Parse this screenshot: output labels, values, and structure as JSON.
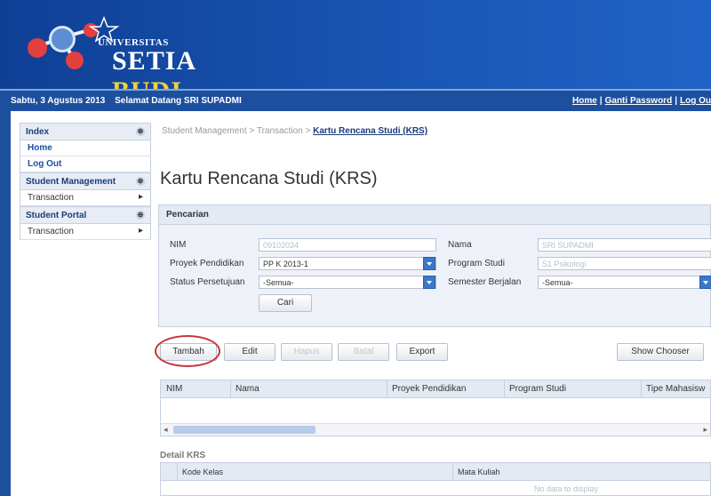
{
  "header": {
    "logo_top": "UNIVERSITAS",
    "logo_brand_a": "SETIA",
    "logo_brand_b": "BUDI"
  },
  "topbar": {
    "date": "Sabtu, 3 Agustus 2013",
    "welcome": "Selamat Datang SRI SUPADMI",
    "links": [
      "Home",
      "Ganti Password",
      "Log Ou"
    ]
  },
  "sidebar": {
    "sections": [
      {
        "title": "Index",
        "items": [
          "Home",
          "Log Out"
        ]
      },
      {
        "title": "Student Management",
        "items": [
          "Transaction"
        ]
      },
      {
        "title": "Student Portal",
        "items": [
          "Transaction"
        ]
      }
    ]
  },
  "breadcrumb": {
    "path1": "Student Management",
    "sep": ">",
    "path2": "Transaction",
    "current": "Kartu Rencana Studi (KRS)"
  },
  "page_title": "Kartu Rencana Studi (KRS)",
  "search": {
    "panel_title": "Pencarian",
    "nim_label": "NIM",
    "nim_value": "09102034",
    "nama_label": "Nama",
    "nama_value": "SRI SUPADMI",
    "proyek_label": "Proyek Pendidikan",
    "proyek_value": "PP K 2013-1",
    "program_label": "Program Studi",
    "program_value": "S1 Psikologi",
    "status_label": "Status Persetujuan",
    "status_value": "-Semua-",
    "semester_label": "Semester Berjalan",
    "semester_value": "-Semua-",
    "cari": "Cari"
  },
  "toolbar": {
    "tambah": "Tambah",
    "edit": "Edit",
    "hapus": "Hapus",
    "batal": "Batal",
    "export": "Export",
    "show_chooser": "Show Chooser"
  },
  "grid": {
    "columns": [
      "NIM",
      "Nama",
      "Proyek Pendidikan",
      "Program Studi",
      "Tipe Mahasisw"
    ]
  },
  "detail": {
    "title": "Detail KRS",
    "columns": [
      "Kode Kelas",
      "Mata Kuliah"
    ],
    "empty": "No data to display"
  },
  "colors": {
    "header_blue": "#1a57b6",
    "accent_yellow": "#f0d23c",
    "highlight_red": "#c8323a"
  }
}
